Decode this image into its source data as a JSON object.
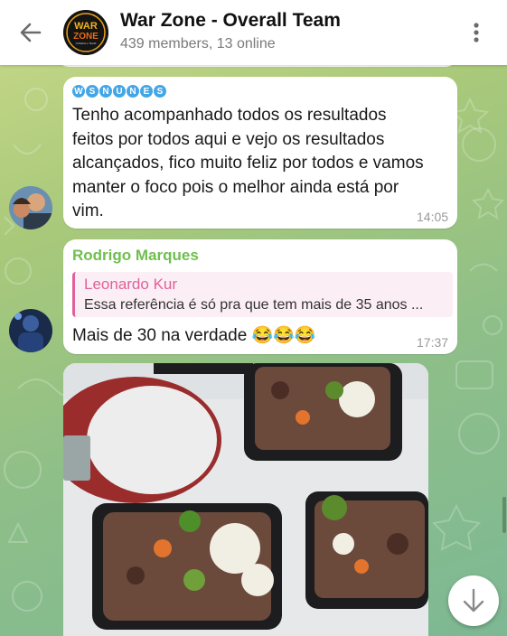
{
  "header": {
    "title": "War Zone - Overall Team",
    "subtitle": "439 members, 13 online",
    "avatar_logo_line1": "WAR",
    "avatar_logo_line2": "ZONE",
    "avatar_logo_line3": "OVERALL TEAM"
  },
  "messages": [
    {
      "sender_tag": [
        "W",
        "S",
        "N",
        "U",
        "N",
        "E",
        "S"
      ],
      "lines": [
        "Tenho acompanhado todos os resultados",
        "feitos por todos aqui e vejo os resultados",
        "alcançados, fico muito feliz por todos e vamos",
        "manter o foco pois o melhor ainda está por",
        "vim."
      ],
      "time": "14:05"
    },
    {
      "sender": "Rodrigo Marques",
      "reply_name": "Leonardo Kur",
      "reply_text": "Essa referência é só pra que tem mais de 35 anos ...",
      "text": "Mais de 30 na verdade 😂😂😂",
      "time": "17:37"
    }
  ],
  "colors": {
    "sender_name": "#6fbf4e",
    "reply_accent": "#e1609b",
    "tag_badge": "#45a6e6"
  }
}
